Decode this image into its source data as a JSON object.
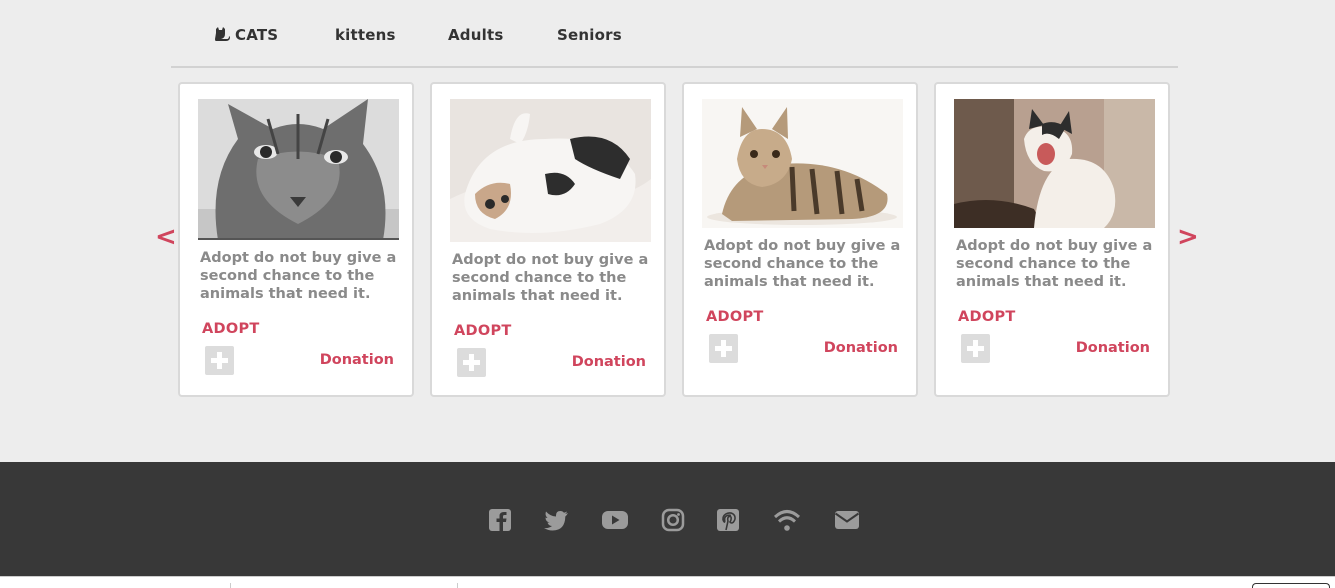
{
  "nav": {
    "tabs": [
      {
        "label": "CATS",
        "icon": "cat-icon"
      },
      {
        "label": "kittens"
      },
      {
        "label": "Adults"
      },
      {
        "label": "Seniors"
      }
    ]
  },
  "carousel": {
    "prev_label": "<",
    "next_label": ">",
    "cards": [
      {
        "description": "Adopt do not buy give a second chance to the animals that need it.",
        "adopt_label": "ADOPT",
        "donation_label": "Donation",
        "image": "grey-tabby-cat-photo"
      },
      {
        "description": "Adopt do not buy give a second chance to the animals that need it.",
        "adopt_label": "ADOPT",
        "donation_label": "Donation",
        "image": "calico-cat-on-back-photo"
      },
      {
        "description": "Adopt do not buy give a second chance to the animals that need it.",
        "adopt_label": "ADOPT",
        "donation_label": "Donation",
        "image": "tabby-kitten-lying-photo"
      },
      {
        "description": "Adopt do not buy give a second chance to the animals that need it.",
        "adopt_label": "ADOPT",
        "donation_label": "Donation",
        "image": "yawning-white-kitten-photo"
      }
    ]
  },
  "footer": {
    "social_icons": [
      "facebook-icon",
      "twitter-icon",
      "youtube-icon",
      "instagram-icon",
      "pinterest-icon",
      "rss-icon",
      "email-icon"
    ]
  },
  "colors": {
    "accent": "#d0455d",
    "footer_bg": "#383838",
    "page_bg": "#ededed",
    "icon_grey": "#9b9b9b"
  }
}
